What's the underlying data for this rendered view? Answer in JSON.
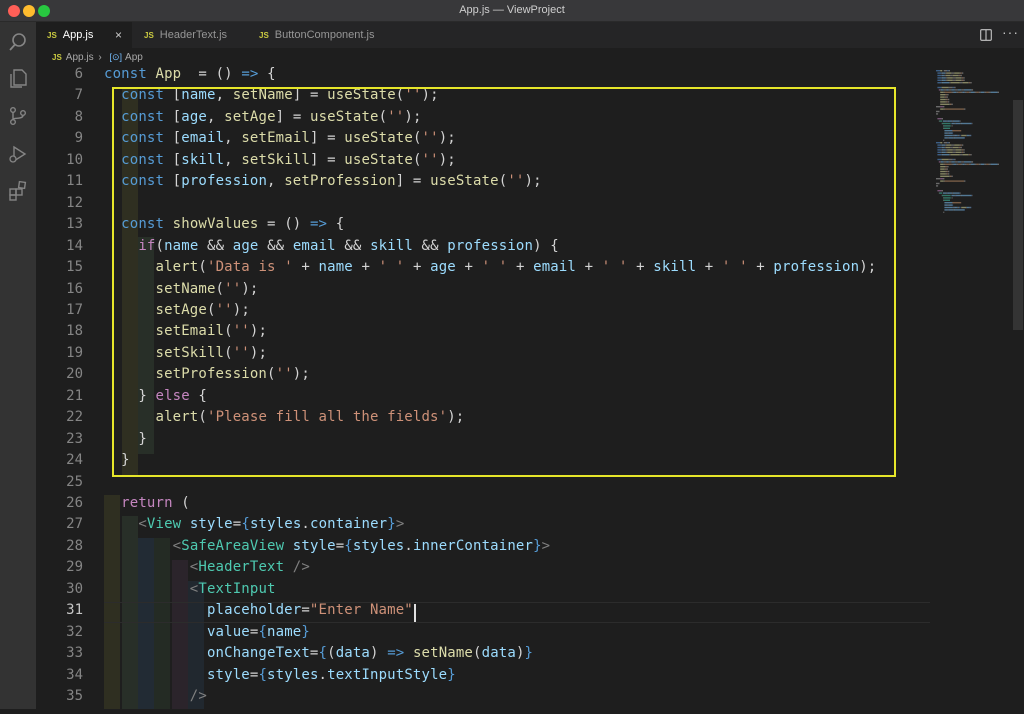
{
  "window": {
    "title": "App.js — ViewProject"
  },
  "tabs": [
    {
      "label": "App.js",
      "icon": "js-file-icon",
      "active": true
    },
    {
      "label": "HeaderText.js",
      "icon": "js-file-icon",
      "active": false
    },
    {
      "label": "ButtonComponent.js",
      "icon": "js-file-icon",
      "active": false
    }
  ],
  "breadcrumb": {
    "file": "App.js",
    "symbol": "App"
  },
  "editor": {
    "current_line": 31,
    "lines": [
      {
        "n": "6",
        "tokens": [
          [
            "kw",
            "const "
          ],
          [
            "fn",
            "App"
          ],
          [
            "",
            "  "
          ],
          [
            "",
            "= () "
          ],
          [
            "kw",
            "=>"
          ],
          [
            "",
            " {"
          ]
        ]
      },
      {
        "n": "7",
        "tokens": [
          [
            "",
            "  "
          ],
          [
            "kw",
            "const "
          ],
          [
            "",
            "["
          ],
          [
            "vr",
            "name"
          ],
          [
            "",
            ", "
          ],
          [
            "fn",
            "setName"
          ],
          [
            "",
            "] = "
          ],
          [
            "fn",
            "useState"
          ],
          [
            "",
            "("
          ],
          [
            "st",
            "''"
          ],
          [
            "",
            ");"
          ]
        ]
      },
      {
        "n": "8",
        "tokens": [
          [
            "",
            "  "
          ],
          [
            "kw",
            "const "
          ],
          [
            "",
            "["
          ],
          [
            "vr",
            "age"
          ],
          [
            "",
            ", "
          ],
          [
            "fn",
            "setAge"
          ],
          [
            "",
            "] = "
          ],
          [
            "fn",
            "useState"
          ],
          [
            "",
            "("
          ],
          [
            "st",
            "''"
          ],
          [
            "",
            ");"
          ]
        ]
      },
      {
        "n": "9",
        "tokens": [
          [
            "",
            "  "
          ],
          [
            "kw",
            "const "
          ],
          [
            "",
            "["
          ],
          [
            "vr",
            "email"
          ],
          [
            "",
            ", "
          ],
          [
            "fn",
            "setEmail"
          ],
          [
            "",
            "] = "
          ],
          [
            "fn",
            "useState"
          ],
          [
            "",
            "("
          ],
          [
            "st",
            "''"
          ],
          [
            "",
            ");"
          ]
        ]
      },
      {
        "n": "10",
        "tokens": [
          [
            "",
            "  "
          ],
          [
            "kw",
            "const "
          ],
          [
            "",
            "["
          ],
          [
            "vr",
            "skill"
          ],
          [
            "",
            ", "
          ],
          [
            "fn",
            "setSkill"
          ],
          [
            "",
            "] = "
          ],
          [
            "fn",
            "useState"
          ],
          [
            "",
            "("
          ],
          [
            "st",
            "''"
          ],
          [
            "",
            ");"
          ]
        ]
      },
      {
        "n": "11",
        "tokens": [
          [
            "",
            "  "
          ],
          [
            "kw",
            "const "
          ],
          [
            "",
            "["
          ],
          [
            "vr",
            "profession"
          ],
          [
            "",
            ", "
          ],
          [
            "fn",
            "setProfession"
          ],
          [
            "",
            "] = "
          ],
          [
            "fn",
            "useState"
          ],
          [
            "",
            "("
          ],
          [
            "st",
            "''"
          ],
          [
            "",
            ");"
          ]
        ]
      },
      {
        "n": "12",
        "tokens": []
      },
      {
        "n": "13",
        "tokens": [
          [
            "",
            "  "
          ],
          [
            "kw",
            "const "
          ],
          [
            "fn",
            "showValues"
          ],
          [
            "",
            " = () "
          ],
          [
            "kw",
            "=>"
          ],
          [
            "",
            " {"
          ]
        ]
      },
      {
        "n": "14",
        "tokens": [
          [
            "",
            "    "
          ],
          [
            "cf",
            "if"
          ],
          [
            "",
            "("
          ],
          [
            "vr",
            "name"
          ],
          [
            "",
            " && "
          ],
          [
            "vr",
            "age"
          ],
          [
            "",
            " && "
          ],
          [
            "vr",
            "email"
          ],
          [
            "",
            " && "
          ],
          [
            "vr",
            "skill"
          ],
          [
            "",
            " && "
          ],
          [
            "vr",
            "profession"
          ],
          [
            "",
            ") {"
          ]
        ]
      },
      {
        "n": "15",
        "tokens": [
          [
            "",
            "      "
          ],
          [
            "fn",
            "alert"
          ],
          [
            "",
            "("
          ],
          [
            "st",
            "'Data is '"
          ],
          [
            "",
            " + "
          ],
          [
            "vr",
            "name"
          ],
          [
            "",
            " + "
          ],
          [
            "st",
            "' '"
          ],
          [
            "",
            " + "
          ],
          [
            "vr",
            "age"
          ],
          [
            "",
            " + "
          ],
          [
            "st",
            "' '"
          ],
          [
            "",
            " + "
          ],
          [
            "vr",
            "email"
          ],
          [
            "",
            " + "
          ],
          [
            "st",
            "' '"
          ],
          [
            "",
            " + "
          ],
          [
            "vr",
            "skill"
          ],
          [
            "",
            " + "
          ],
          [
            "st",
            "' '"
          ],
          [
            "",
            " + "
          ],
          [
            "vr",
            "profession"
          ],
          [
            "",
            ");"
          ]
        ]
      },
      {
        "n": "16",
        "tokens": [
          [
            "",
            "      "
          ],
          [
            "fn",
            "setName"
          ],
          [
            "",
            "("
          ],
          [
            "st",
            "''"
          ],
          [
            "",
            ");"
          ]
        ]
      },
      {
        "n": "17",
        "tokens": [
          [
            "",
            "      "
          ],
          [
            "fn",
            "setAge"
          ],
          [
            "",
            "("
          ],
          [
            "st",
            "''"
          ],
          [
            "",
            ");"
          ]
        ]
      },
      {
        "n": "18",
        "tokens": [
          [
            "",
            "      "
          ],
          [
            "fn",
            "setEmail"
          ],
          [
            "",
            "("
          ],
          [
            "st",
            "''"
          ],
          [
            "",
            ");"
          ]
        ]
      },
      {
        "n": "19",
        "tokens": [
          [
            "",
            "      "
          ],
          [
            "fn",
            "setSkill"
          ],
          [
            "",
            "("
          ],
          [
            "st",
            "''"
          ],
          [
            "",
            ");"
          ]
        ]
      },
      {
        "n": "20",
        "tokens": [
          [
            "",
            "      "
          ],
          [
            "fn",
            "setProfession"
          ],
          [
            "",
            "("
          ],
          [
            "st",
            "''"
          ],
          [
            "",
            ");"
          ]
        ]
      },
      {
        "n": "21",
        "tokens": [
          [
            "",
            "    } "
          ],
          [
            "cf",
            "else"
          ],
          [
            "",
            " {"
          ]
        ]
      },
      {
        "n": "22",
        "tokens": [
          [
            "",
            "      "
          ],
          [
            "fn",
            "alert"
          ],
          [
            "",
            "("
          ],
          [
            "st",
            "'Please fill all the fields'"
          ],
          [
            "",
            ");"
          ]
        ]
      },
      {
        "n": "23",
        "tokens": [
          [
            "",
            "    }"
          ]
        ]
      },
      {
        "n": "24",
        "tokens": [
          [
            "",
            "  }"
          ]
        ]
      },
      {
        "n": "25",
        "tokens": []
      },
      {
        "n": "26",
        "tokens": [
          [
            "",
            "  "
          ],
          [
            "cf",
            "return"
          ],
          [
            "",
            " ("
          ]
        ]
      },
      {
        "n": "27",
        "tokens": [
          [
            "",
            "    "
          ],
          [
            "pn",
            "<"
          ],
          [
            "tg",
            "View"
          ],
          [
            "",
            " "
          ],
          [
            "vr",
            "style"
          ],
          [
            "",
            "="
          ],
          [
            "kw",
            "{"
          ],
          [
            "vr",
            "styles"
          ],
          [
            "",
            "."
          ],
          [
            "vr",
            "container"
          ],
          [
            "kw",
            "}"
          ],
          [
            "pn",
            ">"
          ]
        ]
      },
      {
        "n": "28",
        "tokens": [
          [
            "",
            "        "
          ],
          [
            "pn",
            "<"
          ],
          [
            "tg",
            "SafeAreaView"
          ],
          [
            "",
            " "
          ],
          [
            "vr",
            "style"
          ],
          [
            "",
            "="
          ],
          [
            "kw",
            "{"
          ],
          [
            "vr",
            "styles"
          ],
          [
            "",
            "."
          ],
          [
            "vr",
            "innerContainer"
          ],
          [
            "kw",
            "}"
          ],
          [
            "pn",
            ">"
          ]
        ]
      },
      {
        "n": "29",
        "tokens": [
          [
            "",
            "          "
          ],
          [
            "pn",
            "<"
          ],
          [
            "tg",
            "HeaderText"
          ],
          [
            "",
            " "
          ],
          [
            "pn",
            "/>"
          ]
        ]
      },
      {
        "n": "30",
        "tokens": [
          [
            "",
            "          "
          ],
          [
            "pn",
            "<"
          ],
          [
            "tg",
            "TextInput"
          ]
        ]
      },
      {
        "n": "31",
        "tokens": [
          [
            "",
            "            "
          ],
          [
            "vr",
            "placeholder"
          ],
          [
            "",
            "="
          ],
          [
            "st",
            "\"Enter Name\""
          ]
        ]
      },
      {
        "n": "32",
        "tokens": [
          [
            "",
            "            "
          ],
          [
            "vr",
            "value"
          ],
          [
            "",
            "="
          ],
          [
            "kw",
            "{"
          ],
          [
            "vr",
            "name"
          ],
          [
            "kw",
            "}"
          ]
        ]
      },
      {
        "n": "33",
        "tokens": [
          [
            "",
            "            "
          ],
          [
            "vr",
            "onChangeText"
          ],
          [
            "",
            "="
          ],
          [
            "kw",
            "{"
          ],
          [
            "",
            "("
          ],
          [
            "vr",
            "data"
          ],
          [
            "",
            ") "
          ],
          [
            "kw",
            "=>"
          ],
          [
            "",
            " "
          ],
          [
            "fn",
            "setName"
          ],
          [
            "",
            "("
          ],
          [
            "vr",
            "data"
          ],
          [
            "",
            ")"
          ],
          [
            "kw",
            "}"
          ]
        ]
      },
      {
        "n": "34",
        "tokens": [
          [
            "",
            "            "
          ],
          [
            "vr",
            "style"
          ],
          [
            "",
            "="
          ],
          [
            "kw",
            "{"
          ],
          [
            "vr",
            "styles"
          ],
          [
            "",
            "."
          ],
          [
            "vr",
            "textInputStyle"
          ],
          [
            "kw",
            "}"
          ]
        ]
      },
      {
        "n": "35",
        "tokens": [
          [
            "",
            "          "
          ],
          [
            "pn",
            "/>"
          ]
        ]
      }
    ]
  },
  "colors": {
    "highlight_box": "#e6e62a",
    "js_icon": "#cbcb41"
  }
}
